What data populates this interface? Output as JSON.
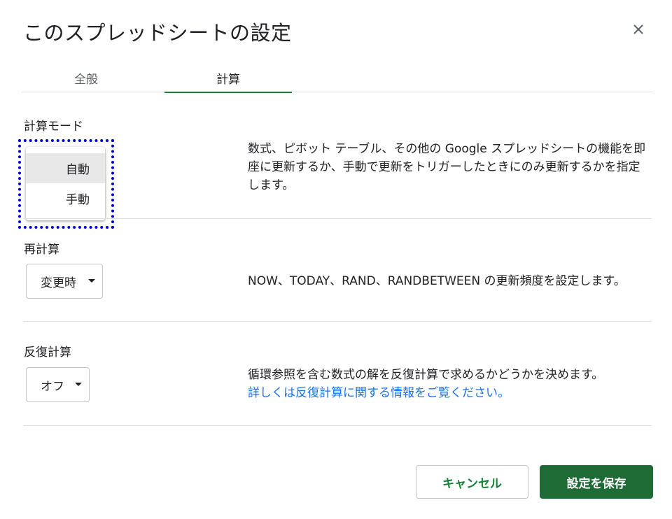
{
  "dialog": {
    "title": "このスプレッドシートの設定",
    "close_icon": "close-icon"
  },
  "tabs": [
    {
      "label": "全般",
      "active": false
    },
    {
      "label": "計算",
      "active": true
    }
  ],
  "calc_mode": {
    "label": "計算モード",
    "options": [
      "自動",
      "手動"
    ],
    "highlighted": "自動",
    "description": "数式、ピボット テーブル、その他の Google スプレッドシートの機能を即座に更新するか、手動で更新をトリガーしたときにのみ更新するかを指定します。"
  },
  "recalculation": {
    "label": "再計算",
    "selected": "変更時",
    "description": "NOW、TODAY、RAND、RANDBETWEEN の更新頻度を設定します。"
  },
  "iterative": {
    "label": "反復計算",
    "selected": "オフ",
    "description": "循環参照を含む数式の解を反復計算で求めるかどうかを決めます。",
    "link": "詳しくは反復計算に関する情報をご覧ください。"
  },
  "footer": {
    "cancel_label": "キャンセル",
    "save_label": "設定を保存"
  },
  "colors": {
    "accent": "#188038",
    "save_button": "#1e6b35",
    "link": "#1a73e8",
    "focus_outline": "#0000dd"
  }
}
